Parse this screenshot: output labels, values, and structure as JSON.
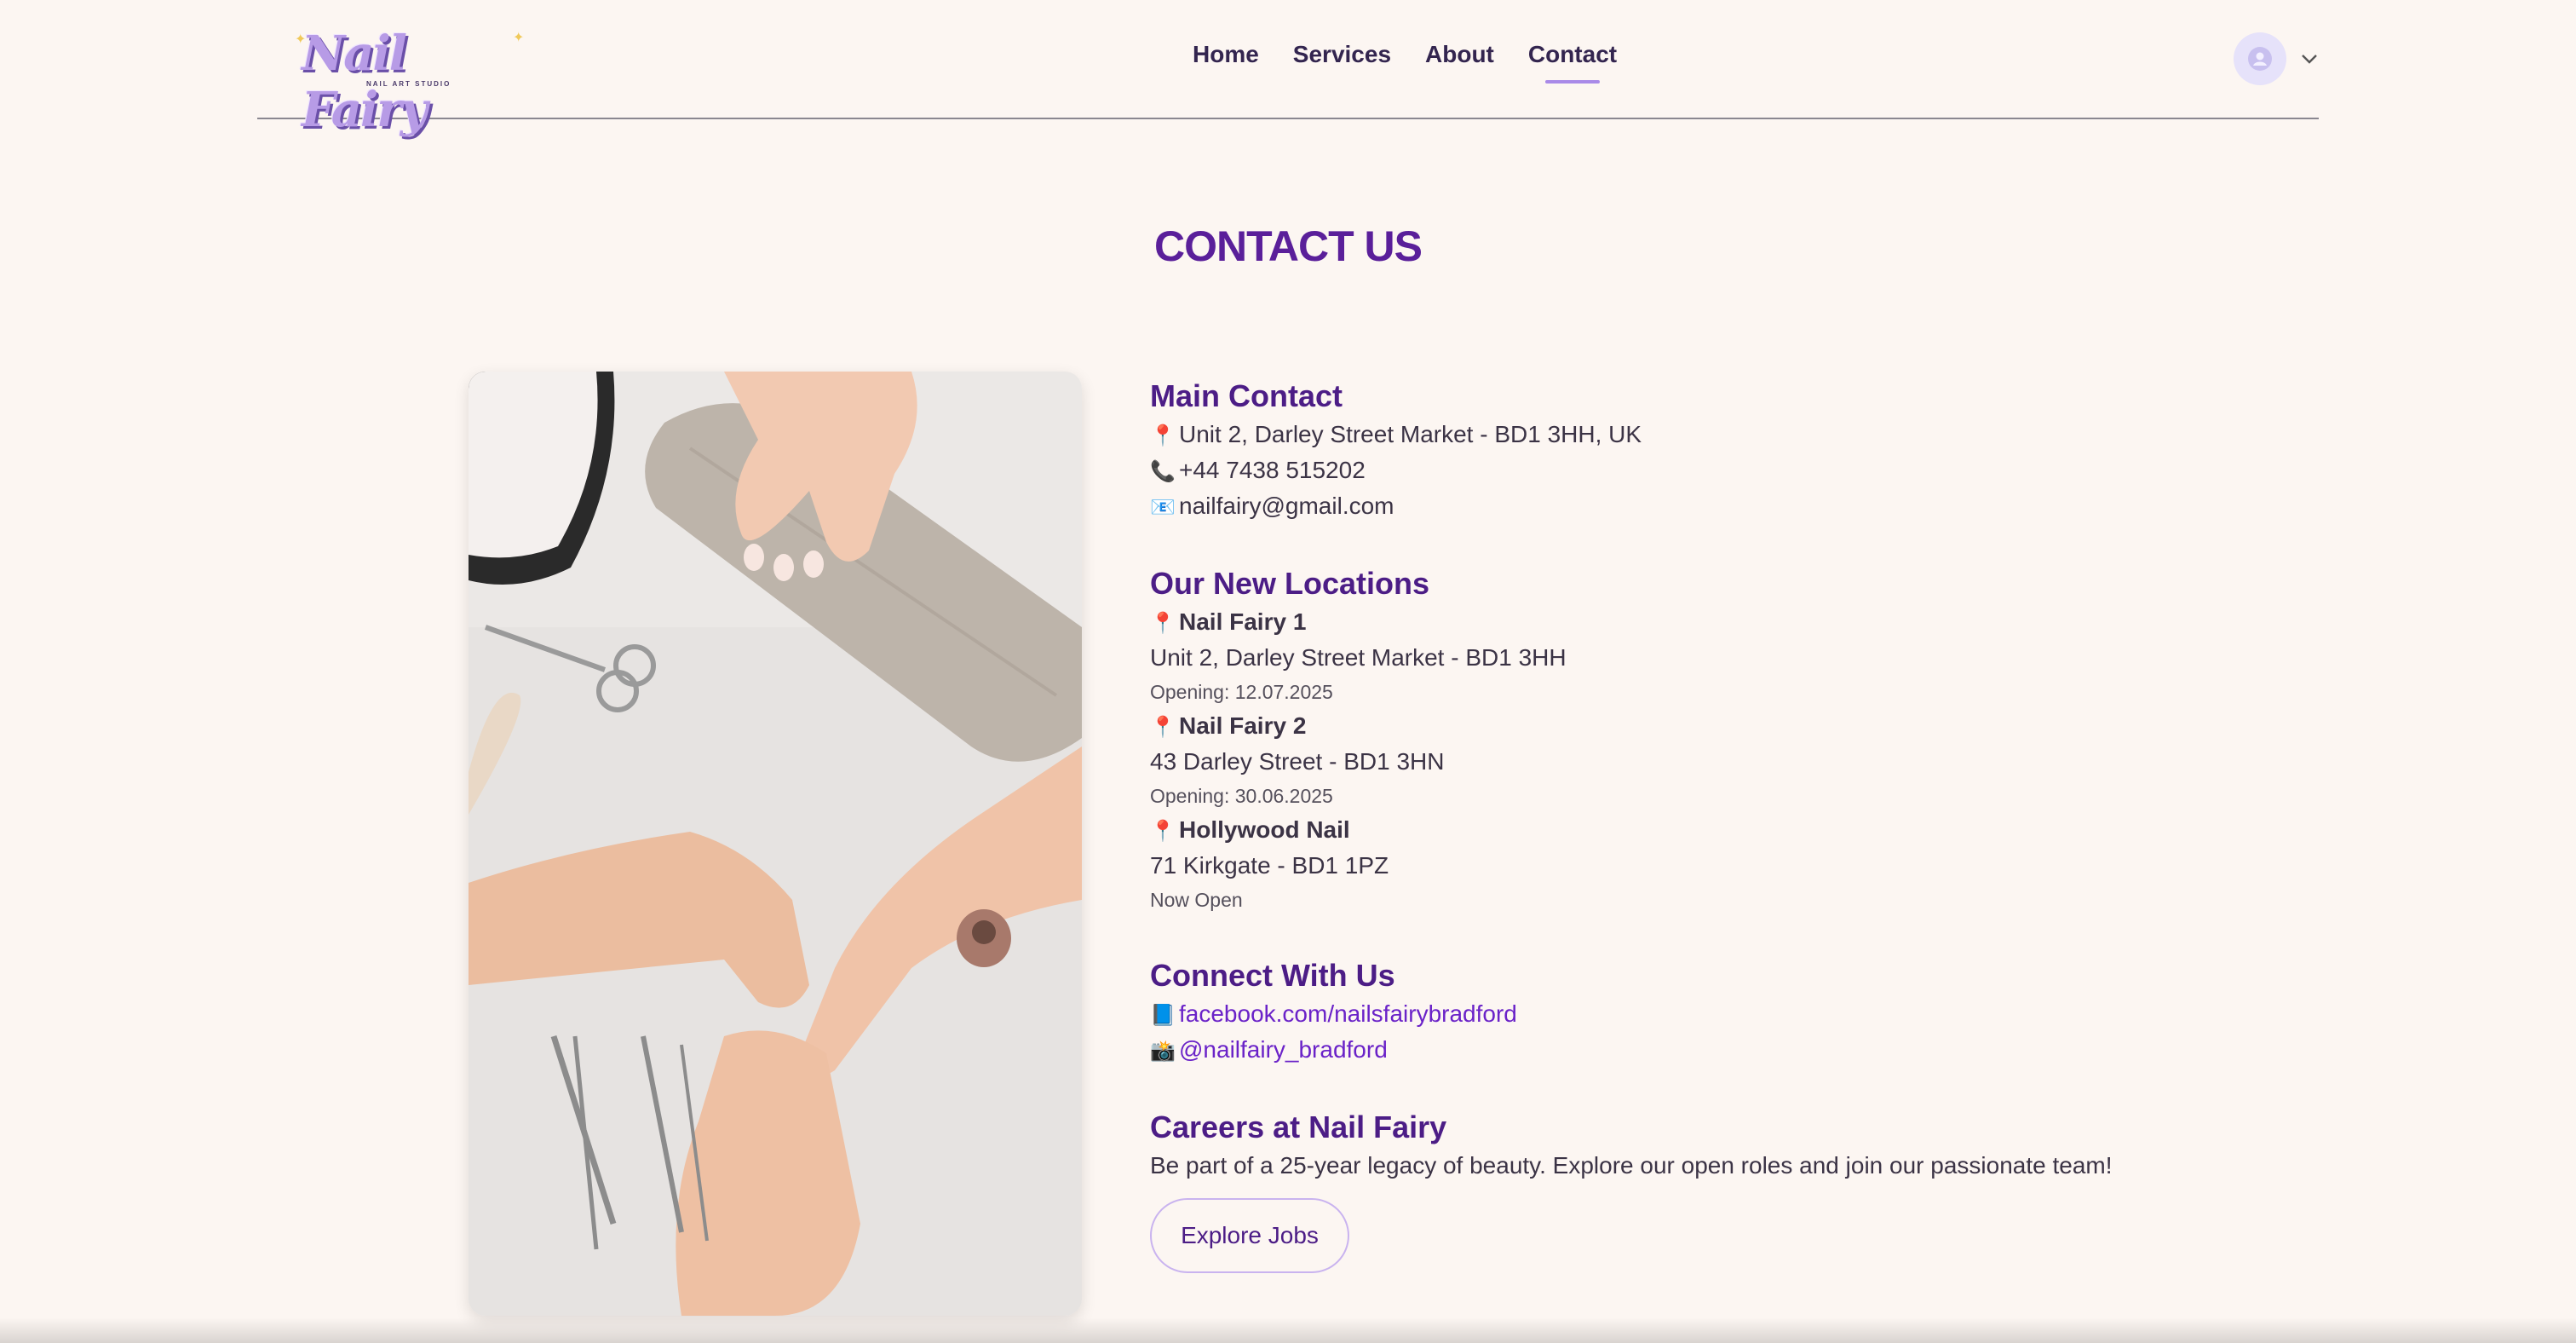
{
  "brand": {
    "logo_text": "Nail Fairy",
    "logo_tagline": "NAIL ART STUDIO"
  },
  "nav": {
    "items": [
      {
        "label": "Home"
      },
      {
        "label": "Services"
      },
      {
        "label": "About"
      },
      {
        "label": "Contact"
      }
    ],
    "active": "Contact"
  },
  "page": {
    "title": "CONTACT US"
  },
  "main_contact": {
    "heading": "Main Contact",
    "address": "Unit 2, Darley Street Market - BD1 3HH, UK",
    "phone": "+44 7438 515202",
    "email": "nailfairy@gmail.com"
  },
  "locations": {
    "heading": "Our New Locations",
    "items": [
      {
        "name": "Nail Fairy 1",
        "address": "Unit 2, Darley Street Market - BD1 3HH",
        "status": "Opening: 12.07.2025"
      },
      {
        "name": "Nail Fairy 2",
        "address": "43 Darley Street - BD1 3HN",
        "status": "Opening: 30.06.2025"
      },
      {
        "name": "Hollywood Nail",
        "address": "71 Kirkgate - BD1 1PZ",
        "status": "Now Open"
      }
    ]
  },
  "connect": {
    "heading": "Connect With Us",
    "facebook": "facebook.com/nailsfairybradford",
    "instagram": "@nailfairy_bradford"
  },
  "careers": {
    "heading": "Careers at Nail Fairy",
    "text": "Be part of a 25-year legacy of beauty. Explore our open roles and join our passionate team!",
    "button_label": "Explore Jobs"
  },
  "icons": {
    "pin": "📍",
    "phone": "📞",
    "email": "📧",
    "facebook": "📘",
    "instagram": "📸"
  },
  "colors": {
    "background": "#fcf6f2",
    "heading_purple": "#4c1d86",
    "link_purple": "#6a22c8",
    "accent_lilac": "#a98ae8"
  }
}
